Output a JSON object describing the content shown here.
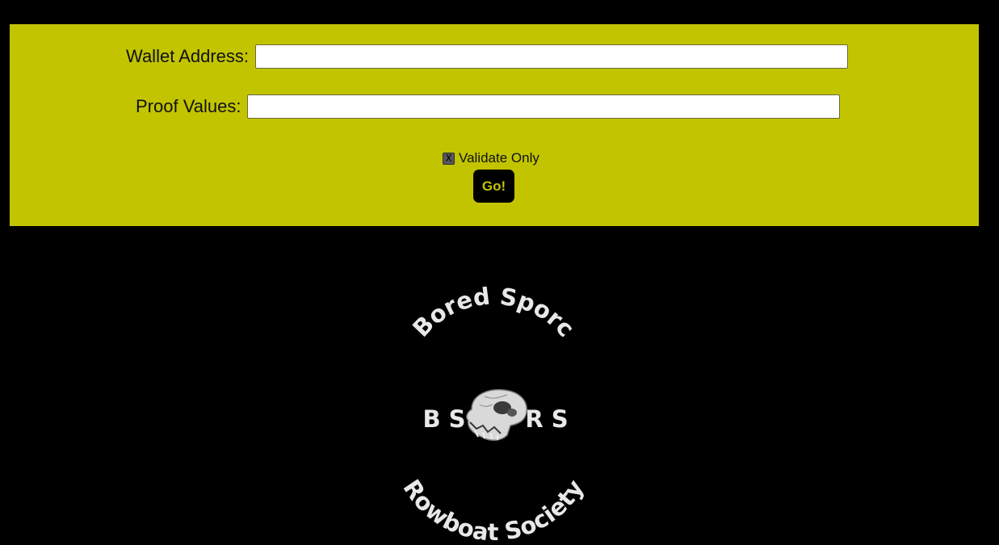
{
  "form": {
    "wallet_label": "Wallet Address:",
    "wallet_value": "",
    "proof_label": "Proof Values:",
    "proof_value": "",
    "validate_checkbox_glyph": "X",
    "validate_label": "Validate Only",
    "validate_checked": true,
    "submit_label": "Go!"
  },
  "logo": {
    "top_text": "Bored Sporc",
    "mid_left": "B S",
    "mid_right": "R S",
    "bottom_text": "Rowboat Society",
    "icon": "primate-skull-icon"
  },
  "colors": {
    "panel_bg": "#c2c400",
    "page_bg": "#000000",
    "button_bg": "#000000",
    "button_text": "#c2c400",
    "logo_text": "#e8e8e8"
  }
}
